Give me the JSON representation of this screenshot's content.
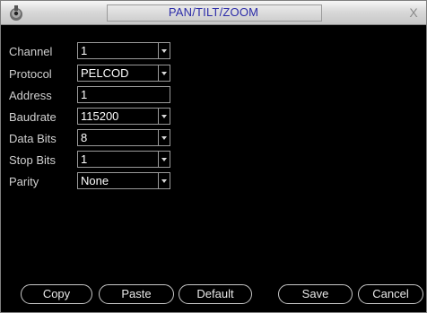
{
  "window": {
    "title": "PAN/TILT/ZOOM",
    "close_label": "X"
  },
  "form": {
    "channel": {
      "label": "Channel",
      "value": "1"
    },
    "protocol": {
      "label": "Protocol",
      "value": "PELCOD"
    },
    "address": {
      "label": "Address",
      "value": "1"
    },
    "baudrate": {
      "label": "Baudrate",
      "value": "115200"
    },
    "data_bits": {
      "label": "Data Bits",
      "value": "8"
    },
    "stop_bits": {
      "label": "Stop Bits",
      "value": "1"
    },
    "parity": {
      "label": "Parity",
      "value": "None"
    }
  },
  "buttons": {
    "copy": "Copy",
    "paste": "Paste",
    "default": "Default",
    "save": "Save",
    "cancel": "Cancel"
  }
}
